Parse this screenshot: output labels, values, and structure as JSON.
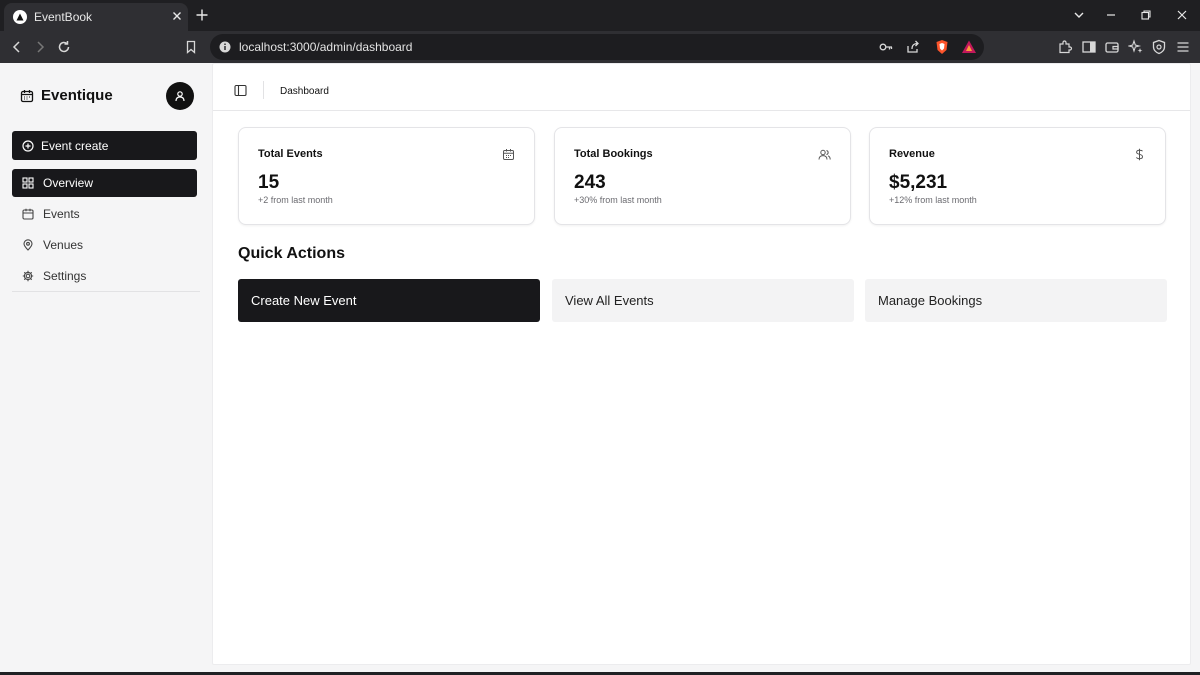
{
  "browser": {
    "tab_title": "EventBook",
    "url": "localhost:3000/admin/dashboard"
  },
  "sidebar": {
    "brand": "Eventique",
    "create_button": "Event create",
    "items": [
      {
        "label": "Overview",
        "icon": "grid-icon",
        "active": true
      },
      {
        "label": "Events",
        "icon": "calendar-icon",
        "active": false
      },
      {
        "label": "Venues",
        "icon": "map-pin-icon",
        "active": false
      },
      {
        "label": "Settings",
        "icon": "gear-icon",
        "active": false
      }
    ]
  },
  "header": {
    "breadcrumb": "Dashboard"
  },
  "stats": [
    {
      "title": "Total Events",
      "value": "15",
      "sub": "+2 from last month",
      "icon": "calendar-icon"
    },
    {
      "title": "Total Bookings",
      "value": "243",
      "sub": "+30% from last month",
      "icon": "users-icon"
    },
    {
      "title": "Revenue",
      "value": "$5,231",
      "sub": "+12% from last month",
      "icon": "dollar-icon"
    }
  ],
  "quick_actions": {
    "title": "Quick Actions",
    "buttons": [
      "Create New Event",
      "View All Events",
      "Manage Bookings"
    ]
  },
  "colors": {
    "primary": "#18181b",
    "secondary_button": "#f3f3f4",
    "sidebar_bg": "#f5f5f6",
    "card_border": "#e4e4e7",
    "muted_text": "#6b6b70"
  }
}
